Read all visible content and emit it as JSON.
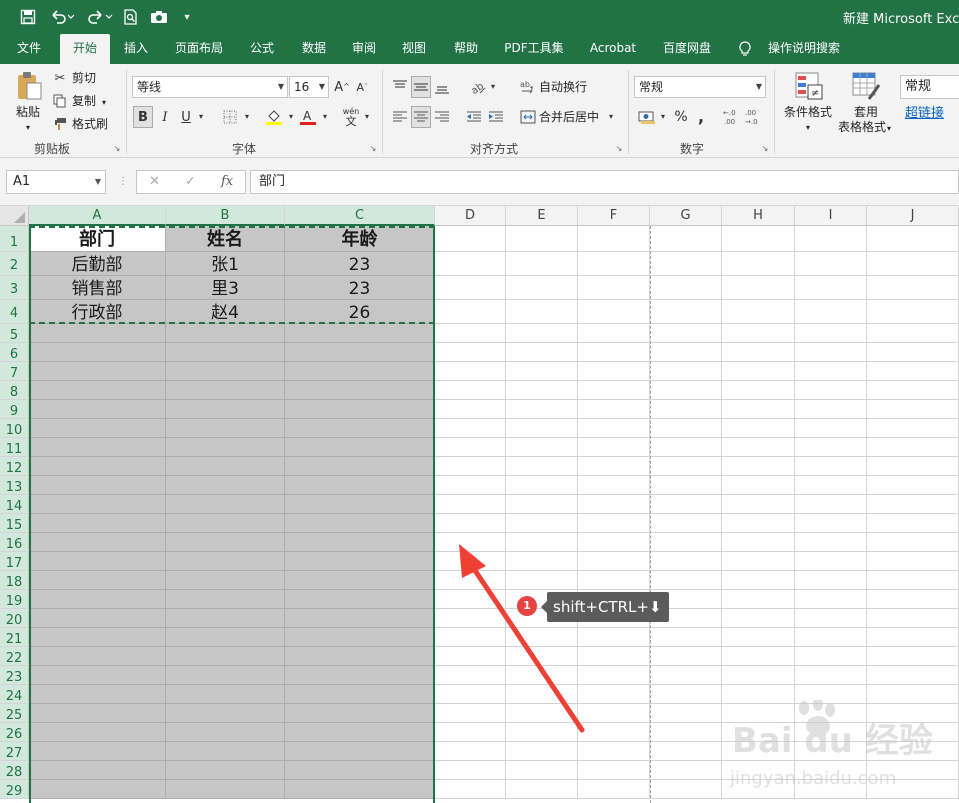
{
  "title_bar": {
    "title": "新建 Microsoft Excel",
    "qat": [
      {
        "name": "save-icon",
        "glyph": "💾"
      },
      {
        "name": "undo-icon",
        "glyph": "↶"
      },
      {
        "name": "redo-icon",
        "glyph": "↷"
      },
      {
        "name": "print-preview-icon",
        "glyph": "🔍"
      },
      {
        "name": "camera-icon",
        "glyph": "📷"
      },
      {
        "name": "customize-qat-icon",
        "glyph": "⌄"
      }
    ]
  },
  "tabs": [
    {
      "label": "文件",
      "active": false
    },
    {
      "label": "开始",
      "active": true
    },
    {
      "label": "插入",
      "active": false
    },
    {
      "label": "页面布局",
      "active": false
    },
    {
      "label": "公式",
      "active": false
    },
    {
      "label": "数据",
      "active": false
    },
    {
      "label": "审阅",
      "active": false
    },
    {
      "label": "视图",
      "active": false
    },
    {
      "label": "帮助",
      "active": false
    },
    {
      "label": "PDF工具集",
      "active": false
    },
    {
      "label": "Acrobat",
      "active": false
    },
    {
      "label": "百度网盘",
      "active": false
    }
  ],
  "tell_me": "操作说明搜索",
  "ribbon": {
    "clipboard": {
      "group": "剪贴板",
      "paste": "粘贴",
      "cut": "剪切",
      "copy": "复制",
      "format_painter": "格式刷"
    },
    "font": {
      "group": "字体",
      "font_name": "等线",
      "font_size": "16",
      "bold": "B",
      "italic": "I",
      "underline": "U",
      "phonetic": "wén",
      "phonetic_char": "文"
    },
    "alignment": {
      "group": "对齐方式",
      "wrap_text": "自动换行",
      "merge_center": "合并后居中"
    },
    "number": {
      "group": "数字",
      "format": "常规",
      "percent": "%",
      "comma": ","
    },
    "styles": {
      "conditional_format": "条件格式",
      "table_format_1": "套用",
      "table_format_2": "表格格式",
      "style_normal": "常规",
      "style_hyperlink": "超链接"
    }
  },
  "formula_bar": {
    "name_box": "A1",
    "cancel": "✕",
    "enter": "✓",
    "fx": "fx",
    "formula": "部门"
  },
  "columns": [
    "A",
    "B",
    "C",
    "D",
    "E",
    "F",
    "G",
    "H",
    "I",
    "J"
  ],
  "row_count": 29,
  "rows": [
    [
      "部门",
      "姓名",
      "年龄"
    ],
    [
      "后勤部",
      "张1",
      "23"
    ],
    [
      "销售部",
      "里3",
      "23"
    ],
    [
      "行政部",
      "赵4",
      "26"
    ]
  ],
  "annotation": {
    "badge": "1",
    "shortcut": "shift+CTRL+⬇"
  },
  "watermark": {
    "brand": "Bai du 经验",
    "url": "jingyan.baidu.com"
  }
}
